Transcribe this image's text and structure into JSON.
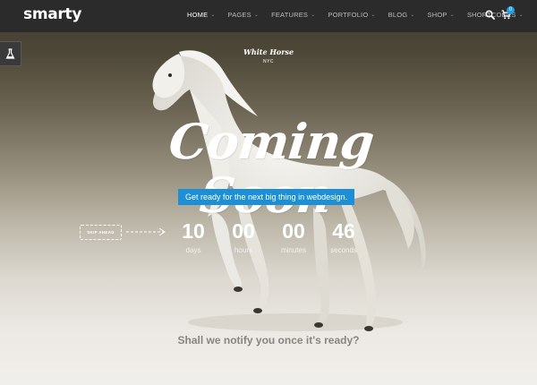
{
  "navbar": {
    "logo": "smarty",
    "items": [
      {
        "label": "HOME",
        "active": true
      },
      {
        "label": "PAGES",
        "active": false
      },
      {
        "label": "FEATURES",
        "active": false
      },
      {
        "label": "PORTFOLIO",
        "active": false
      },
      {
        "label": "BLOG",
        "active": false
      },
      {
        "label": "SHOP",
        "active": false
      },
      {
        "label": "SHORTCODES",
        "active": false
      }
    ],
    "cart_count": "0"
  },
  "hero": {
    "brand": "White Horse",
    "brand_sub": "NYC",
    "headline": "Coming Soon",
    "tagline": "Get ready for the next big thing in webdesign.",
    "skip_label": "SKIP AHEAD",
    "countdown": [
      {
        "value": "10",
        "label": "days"
      },
      {
        "value": "00",
        "label": "hours"
      },
      {
        "value": "00",
        "label": "minutes"
      },
      {
        "value": "46",
        "label": "seconds"
      }
    ],
    "notify": "Shall we notify you once it's ready?"
  },
  "colors": {
    "accent": "#1c8fd6",
    "navbar": "#2b2b2b"
  }
}
